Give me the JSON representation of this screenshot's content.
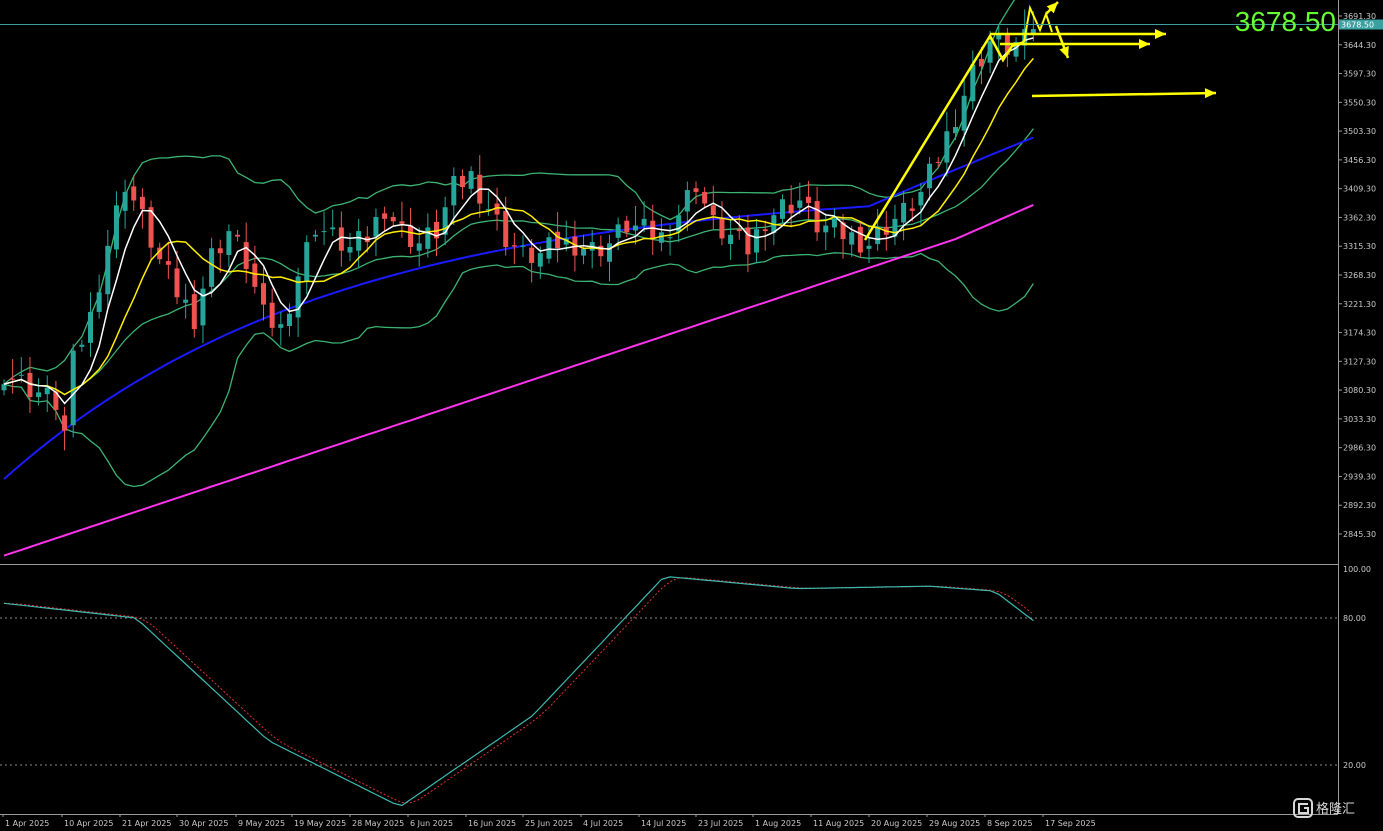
{
  "chart_data": {
    "type": "candlestick",
    "symbol_price": "3678.50",
    "current_price_tag": "3678.50",
    "price_axis": {
      "ticks": [
        "3691.30",
        "3644.30",
        "3597.30",
        "3550.30",
        "3503.30",
        "3456.30",
        "3409.30",
        "3362.30",
        "3315.30",
        "3268.30",
        "3221.30",
        "3174.30",
        "3127.30",
        "3080.30",
        "3033.30",
        "2986.30",
        "2939.30",
        "2892.30",
        "2845.30"
      ],
      "ylim": [
        2810,
        3710
      ]
    },
    "date_axis": {
      "labels": [
        "1 Apr 2025",
        "10 Apr 2025",
        "21 Apr 2025",
        "30 Apr 2025",
        "9 May 2025",
        "19 May 2025",
        "28 May 2025",
        "6 Jun 2025",
        "16 Jun 2025",
        "25 Jun 2025",
        "4 Jul 2025",
        "14 Jul 2025",
        "23 Jul 2025",
        "1 Aug 2025",
        "11 Aug 2025",
        "20 Aug 2025",
        "29 Aug 2025",
        "8 Sep 2025",
        "17 Sep 2025"
      ]
    },
    "stochastic_axis": {
      "ticks": [
        "100.00",
        "80.00",
        "20.00"
      ],
      "ylim": [
        0,
        100
      ]
    },
    "colors": {
      "bull": "#26a69a",
      "bear": "#ef5350",
      "ma_fast": "#ffffff",
      "ma_mid": "#ffee00",
      "ma_slow": "#1a1aff",
      "ma_long": "#ff33ee",
      "bollinger": "#3cb371",
      "annotation": "#ffff00",
      "stoch_main": "#3fb8b0",
      "stoch_signal": "#e03030",
      "price_text": "#66ff33"
    }
  },
  "watermark": {
    "text": "格隆汇",
    "icon": "g-logo-icon"
  }
}
